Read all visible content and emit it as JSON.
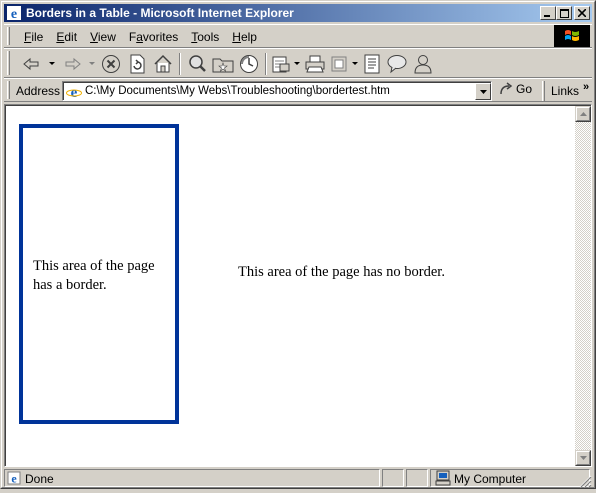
{
  "window": {
    "title": "Borders in a Table - Microsoft Internet Explorer"
  },
  "menu": {
    "items": [
      {
        "key": "F",
        "rest": "ile"
      },
      {
        "key": "E",
        "rest": "dit"
      },
      {
        "key": "V",
        "rest": "iew"
      },
      {
        "key": "a",
        "pre": "F",
        "rest": "vorites"
      },
      {
        "key": "T",
        "rest": "ools"
      },
      {
        "key": "H",
        "rest": "elp"
      }
    ]
  },
  "address": {
    "label": "Address",
    "value": "C:\\My Documents\\My Webs\\Troubleshooting\\bordertest.htm",
    "go_label": "Go",
    "links_label": "Links",
    "links_chevron": "»"
  },
  "page": {
    "bordered_text": "This area of the page has a border.",
    "plain_text": "This area of the page has no border.",
    "border_color": "#003399"
  },
  "status": {
    "left_text": "Done",
    "zone_text": "My Computer"
  },
  "icons": [
    "ie-icon",
    "minimize-icon",
    "maximize-icon",
    "close-icon",
    "windows-logo-icon",
    "back-icon",
    "forward-icon",
    "stop-icon",
    "refresh-icon",
    "home-icon",
    "search-icon",
    "favorites-icon",
    "history-icon",
    "mail-icon",
    "print-icon",
    "edit-icon",
    "discuss-icon",
    "messenger-icon",
    "go-icon",
    "computer-icon"
  ]
}
